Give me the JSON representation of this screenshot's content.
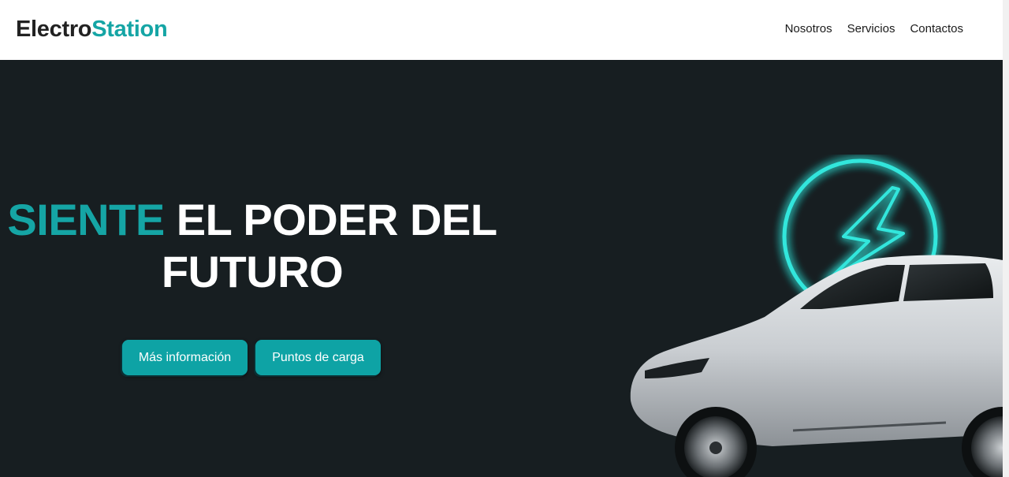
{
  "brand": {
    "part1": "Electro",
    "part2": "Station"
  },
  "nav": {
    "items": [
      "Nosotros",
      "Servicios",
      "Contactos"
    ]
  },
  "hero": {
    "headline_accent": "SIENTE",
    "headline_line1_rest": " EL PODER DEL",
    "headline_line2": "FUTURO",
    "buttons": {
      "info": "Más información",
      "charge": "Puntos de carga"
    }
  },
  "colors": {
    "accent": "#15a5a5",
    "button": "#0ea3a5",
    "hero_bg": "#171e21"
  },
  "icons": {
    "hero_art": "electric-car-with-neon-lightning-icon"
  }
}
